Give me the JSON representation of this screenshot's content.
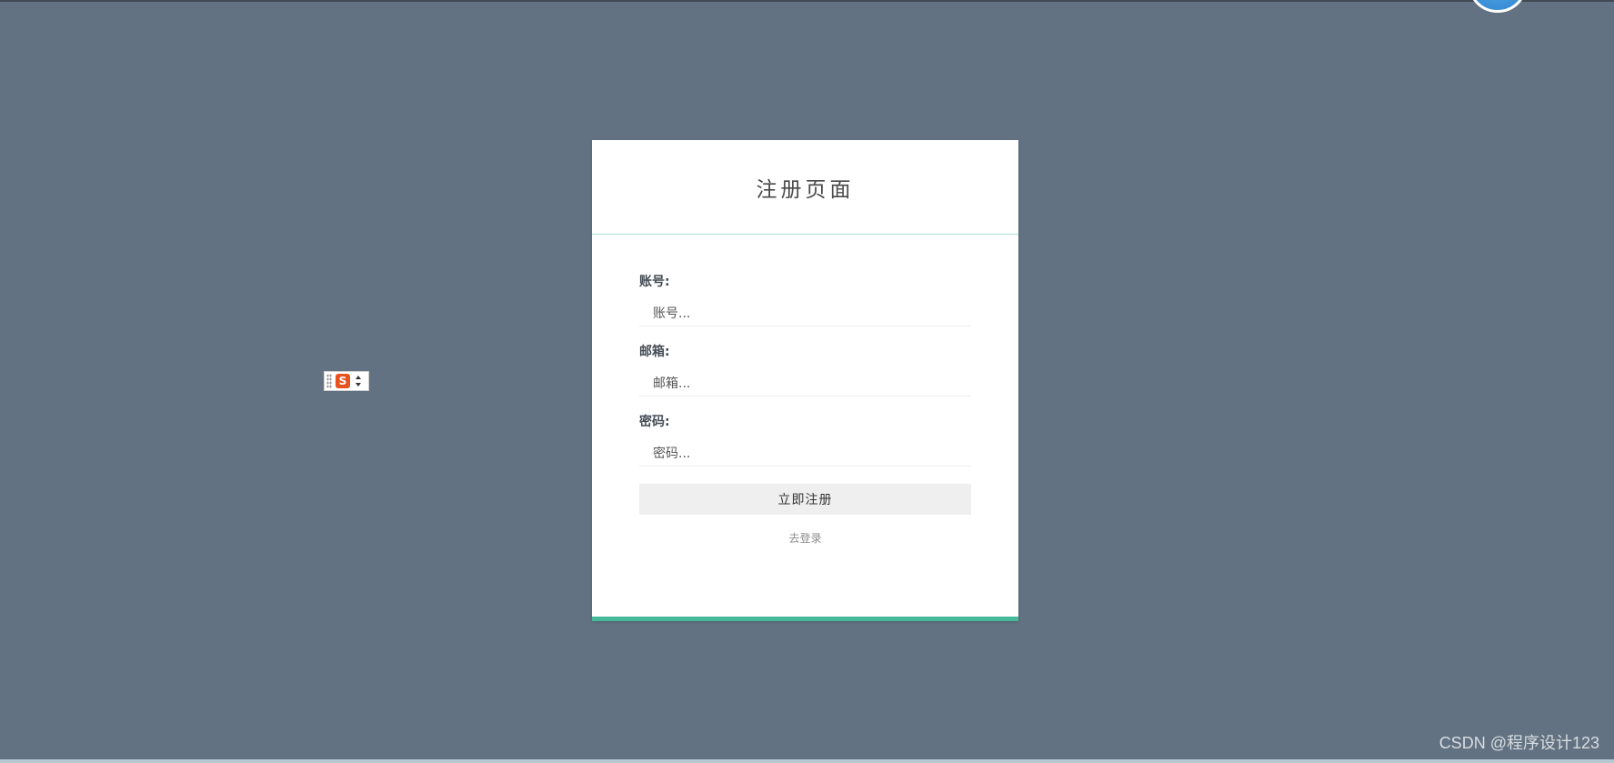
{
  "page": {
    "title": "注册页面"
  },
  "form": {
    "account": {
      "label": "账号:",
      "placeholder": "账号..."
    },
    "email": {
      "label": "邮箱:",
      "placeholder": "邮箱..."
    },
    "password": {
      "label": "密码:",
      "placeholder": "密码..."
    },
    "submit_label": "立即注册",
    "login_link": "去登录"
  },
  "ime_toolbar": {
    "logo_letter": "S"
  },
  "watermark": "CSDN @程序设计123",
  "colors": {
    "background": "#627282",
    "accent": "#46b99a",
    "header_divider": "#a7e2d4",
    "button_bg": "#efefef"
  },
  "icons": {
    "avatar": "user-avatar-icon",
    "ime_logo": "sogou-ime-icon"
  }
}
